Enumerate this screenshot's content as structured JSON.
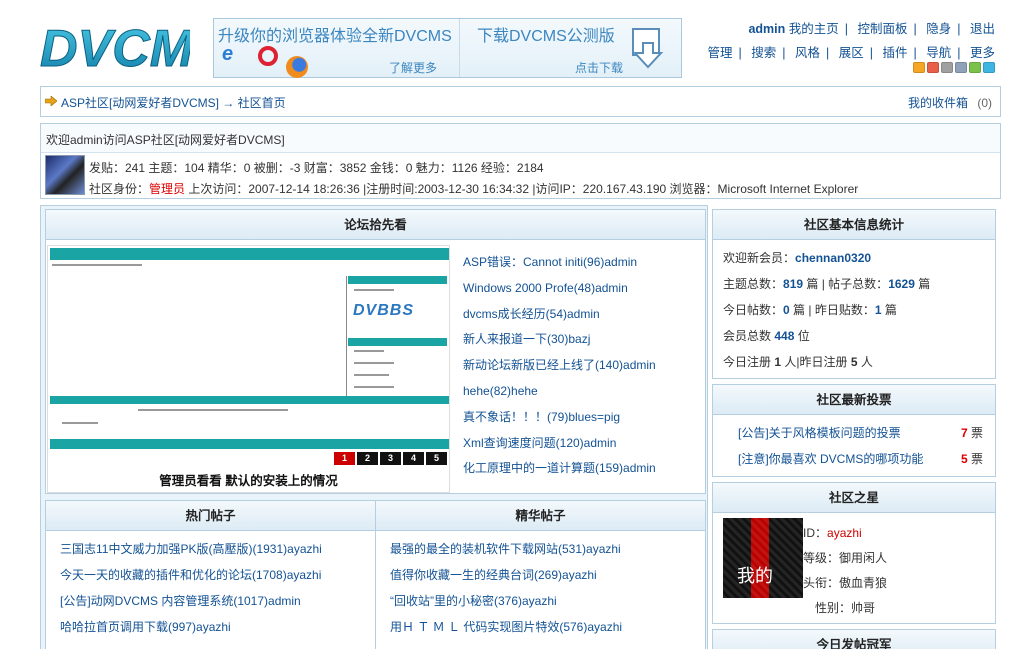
{
  "header": {
    "logo_text": "DVCMS",
    "banner_left_title": "升级你的浏览器体验全新DVCMS",
    "banner_left_sub": "了解更多",
    "banner_right_title": "下载DVCMS公测版",
    "banner_right_sub": "点击下载",
    "user": "admin",
    "row1": [
      "我的主页",
      "控制面板",
      "隐身",
      "退出"
    ],
    "row2": [
      "管理",
      "搜索",
      "风格",
      "展区",
      "插件",
      "导航",
      "更多"
    ],
    "swatches": [
      "#f5a623",
      "#e8604a",
      "#a0a0a0",
      "#8fa2b8",
      "#7cc24a",
      "#3fb6e2"
    ]
  },
  "breadcrumb": {
    "path": "ASP社区[动网爱好者DVCMS] → 社区首页",
    "inbox": "我的收件箱",
    "inbox_count": "(0)"
  },
  "welcome": {
    "title": "欢迎admin访问ASP社区[动网爱好者DVCMS]",
    "line1": "发贴：241 主题：104 精华：0 被删：-3 财富：3852 金钱：0 魅力：1126 经验：2184",
    "identity_label": "社区身份：",
    "identity_value": "管理员",
    "line2_rest": " 上次访问：2007-12-14 18:26:36 |注册时间:2003-12-30 16:34:32 |访问IP：220.167.43.190 浏览器：Microsoft Internet Explorer"
  },
  "picks": {
    "title": "论坛拾先看",
    "shot_logo": "DVBBS",
    "pages": [
      "1",
      "2",
      "3",
      "4",
      "5"
    ],
    "caption": "管理员看看  默认的安装上的情况",
    "items": [
      "ASP错误：Cannot initi(96)admin",
      "Windows 2000 Profe(48)admin",
      "dvcms成长经历(54)admin",
      "新人来报道一下(30)bazj",
      "新动论坛新版已经上线了(140)admin",
      "hehe(82)hehe",
      "真不象话！！！(79)blues=pig",
      "Xml查询速度问题(120)admin",
      "化工原理中的一道计算题(159)admin"
    ]
  },
  "hot": {
    "title": "热门帖子",
    "items": [
      "三国志11中文威力加强PK版(高壓版)(1931)ayazhi",
      "今天一天的收藏的插件和优化的论坛(1708)ayazhi",
      "[公告]动网DVCMS 内容管理系统(1017)admin",
      "哈哈拉首页调用下载(997)ayazhi"
    ]
  },
  "best": {
    "title": "精华帖子",
    "items": [
      "最强的最全的装机软件下载网站(531)ayazhi",
      "值得你收藏一生的经典台词(269)ayazhi",
      "“回收站”里的小秘密(376)ayazhi",
      "用Ｈ Ｔ Ｍ Ｌ 代码实现图片特效(576)ayazhi"
    ]
  },
  "stats": {
    "title": "社区基本信息统计",
    "newest_label": "欢迎新会员：",
    "newest_member": "chennan0320",
    "topics_label": "主题总数：",
    "topics": "819",
    "posts_label": "篇 | 帖子总数：",
    "posts": "1629",
    "unit_pian": "篇",
    "today_label": "今日帖数：",
    "today": "0",
    "yesterday_label": "篇 | 昨日贴数：",
    "yesterday": "1",
    "members_label": "会员总数",
    "members": "448",
    "members_unit": "位",
    "reg_today_label": "今日注册",
    "reg_today": "1",
    "reg_yesterday_label": "人|昨日注册",
    "reg_yesterday": "5",
    "unit_ren": "人"
  },
  "votes": {
    "title": "社区最新投票",
    "items": [
      {
        "text": "[公告]关于风格模板问题的投票",
        "count": "7",
        "unit": "票"
      },
      {
        "text": "[注意]你最喜欢 DVCMS的哪项功能",
        "count": "5",
        "unit": "票"
      }
    ]
  },
  "stars": {
    "title": "社区之星",
    "image_text": "我的",
    "id_label": "ID：",
    "id": "ayazhi",
    "level_label": "等级：",
    "level": "御用闲人",
    "rank_label": "头衔：",
    "rank": "傲血青狼",
    "gender_label": "性别：",
    "gender": "帅哥"
  },
  "champ": {
    "title": "今日发帖冠军"
  }
}
